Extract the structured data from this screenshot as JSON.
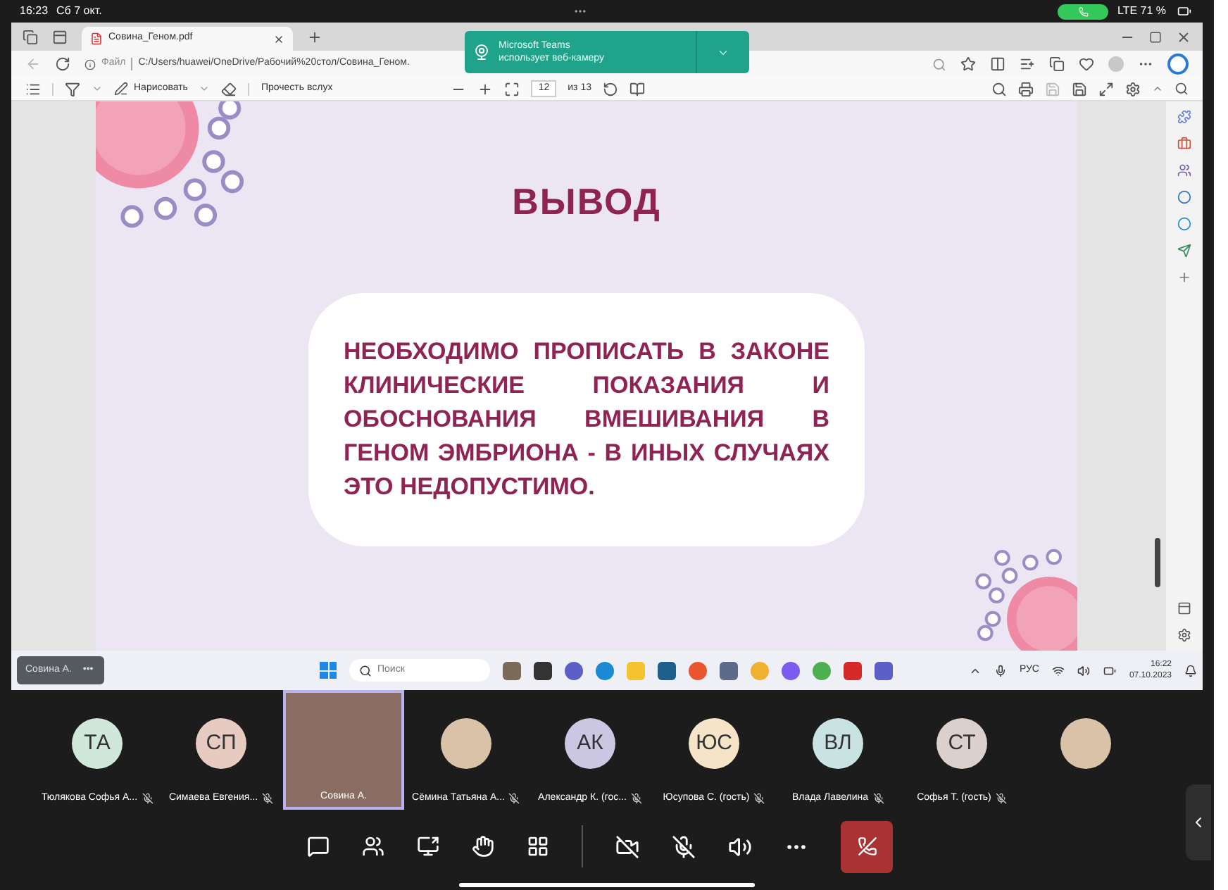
{
  "status_bar": {
    "time": "16:23",
    "date": "Сб 7 окт.",
    "network": "LTE 71 %"
  },
  "browser": {
    "tab": {
      "title": "Совина_Геном.pdf",
      "selected": true
    },
    "address": {
      "info": "Файл",
      "path": "C:/Users/huawei/OneDrive/Рабочий%20стол/Совина_Геном."
    },
    "notification": {
      "app": "Microsoft Teams",
      "message": "использует веб-камеру"
    },
    "pdf_toolbar": {
      "draw": "Нарисовать",
      "read_aloud": "Прочесть вслух",
      "page": "12",
      "page_count": "из 13"
    }
  },
  "slide": {
    "title": "ВЫВОД",
    "body": "НЕОБХОДИМО ПРОПИСАТЬ В ЗАКОНЕ КЛИНИЧЕСКИЕ ПОКАЗАНИЯ И ОБОСНОВАНИЯ ВМЕШИВАНИЯ В ГЕНОМ ЭМБРИОНА - В ИНЫХ СЛУЧАЯХ ЭТО НЕДОПУСТИМО."
  },
  "taskbar": {
    "presenter": "Совина А.",
    "more": "•••",
    "search_placeholder": "Поиск",
    "language": "РУС",
    "time": "16:22",
    "date": "07.10.2023"
  },
  "participants": [
    {
      "kind": "initials",
      "initials": "ТА",
      "name": "Тюлякова Софья А...",
      "color": "#cfe8d9",
      "muted": true,
      "speaking": false
    },
    {
      "kind": "initials",
      "initials": "СП",
      "name": "Симаева Евгения...",
      "color": "#e8cbc0",
      "muted": true,
      "speaking": false
    },
    {
      "kind": "video",
      "name": "Совина А.",
      "muted": false,
      "speaking": true
    },
    {
      "kind": "photo",
      "name": "Сёмина Татьяна А...",
      "muted": true,
      "speaking": false
    },
    {
      "kind": "initials",
      "initials": "АК",
      "name": "Александр К. (гос...",
      "color": "#cbc7e3",
      "muted": true,
      "speaking": false
    },
    {
      "kind": "initials",
      "initials": "ЮС",
      "name": "Юсупова С. (гость)",
      "color": "#f6e4c9",
      "muted": true,
      "speaking": false
    },
    {
      "kind": "initials",
      "initials": "ВЛ",
      "name": "Влада Лавелина",
      "color": "#c9e2e2",
      "muted": true,
      "speaking": false
    },
    {
      "kind": "initials",
      "initials": "СТ",
      "name": "Софья Т. (гость)",
      "color": "#dcd0cc",
      "muted": true,
      "speaking": false
    },
    {
      "kind": "photo",
      "muted": false,
      "speaking": false
    }
  ],
  "call_controls": {
    "camera_on": false,
    "mic_on": false
  }
}
